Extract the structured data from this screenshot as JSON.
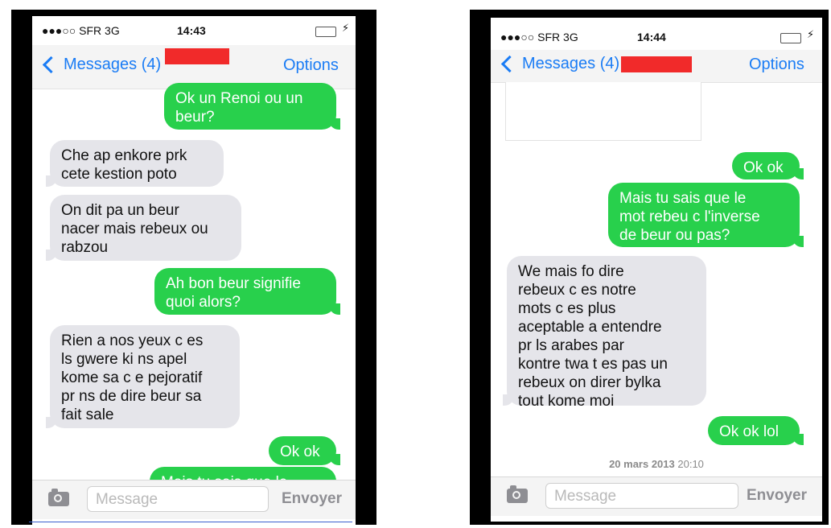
{
  "left_phone": {
    "status": {
      "carrier": "●●●○○ SFR  3G",
      "time": "14:43"
    },
    "nav": {
      "back_label": "Messages (4)",
      "options_label": "Options"
    },
    "messages": [
      {
        "dir": "out",
        "text": "Ok un Renoi ou un\nbeur?"
      },
      {
        "dir": "in",
        "text": "Che ap enkore prk\ncete kestion poto"
      },
      {
        "dir": "in",
        "text": "On dit pa un beur\nnacer mais rebeux ou\nrabzou"
      },
      {
        "dir": "out",
        "text": "Ah bon beur signifie\nquoi alors?"
      },
      {
        "dir": "in",
        "text": "Rien a nos yeux c es\nls gwere ki ns apel\nkome sa c e pejoratif\npr ns de dire beur sa\nfait sale"
      },
      {
        "dir": "out",
        "text": "Ok ok"
      },
      {
        "dir": "out",
        "text": "Mais tu sais que le"
      }
    ],
    "compose": {
      "placeholder": "Message",
      "send_label": "Envoyer"
    }
  },
  "right_phone": {
    "status": {
      "carrier": "●●●○○ SFR  3G",
      "time": "14:44"
    },
    "nav": {
      "back_label": "Messages (4)",
      "options_label": "Options"
    },
    "messages": [
      {
        "dir": "out",
        "text": "Ok ok"
      },
      {
        "dir": "out",
        "text": "Mais tu sais que le\nmot rebeu c l'inverse\nde beur ou pas?"
      },
      {
        "dir": "in",
        "text": "We mais fo dire\nrebeux c es notre\nmots c es plus\naceptable a entendre\npr ls arabes par\nkontre twa t es pas un\nrebeux on direr bylka\ntout kome moi"
      },
      {
        "dir": "out",
        "text": "Ok ok lol"
      }
    ],
    "timestamp": {
      "date": "20 mars 2013",
      "time": "20:10"
    },
    "compose": {
      "placeholder": "Message",
      "send_label": "Envoyer"
    }
  },
  "colors": {
    "outgoing": "#28d04c",
    "incoming": "#e5e5ea",
    "link": "#1a7cf5",
    "redaction": "#f12a2a"
  }
}
